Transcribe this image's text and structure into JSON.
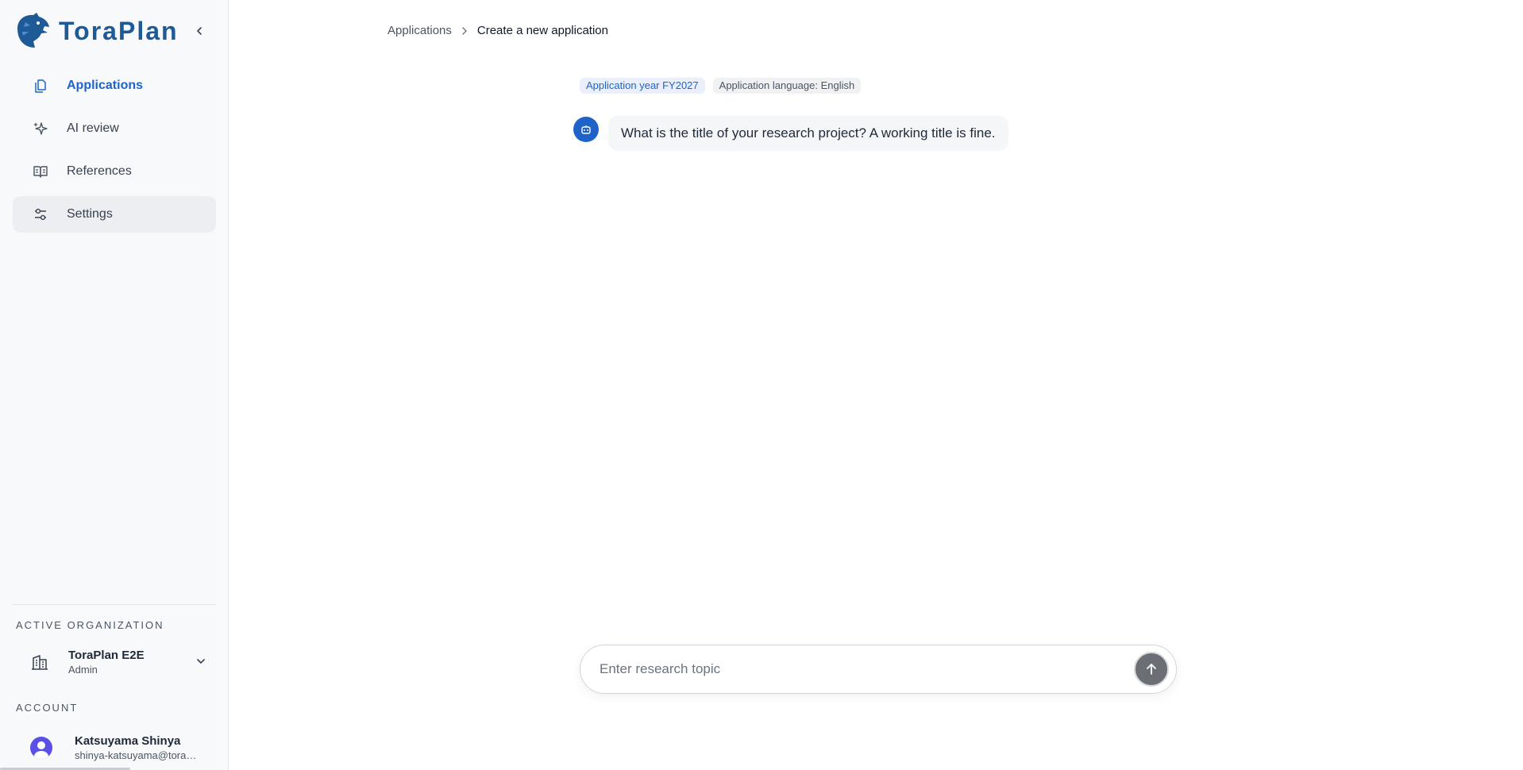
{
  "app": {
    "name": "ToraPlan",
    "brand_color": "#1e5a96",
    "accent_color": "#1f63c9"
  },
  "sidebar": {
    "items": [
      {
        "label": "Applications",
        "icon": "documents-icon",
        "state": "active"
      },
      {
        "label": "AI review",
        "icon": "sparkles-icon",
        "state": "normal"
      },
      {
        "label": "References",
        "icon": "book-open-icon",
        "state": "normal"
      },
      {
        "label": "Settings",
        "icon": "sliders-icon",
        "state": "hover"
      }
    ],
    "active_org_label": "ACTIVE ORGANIZATION",
    "org": {
      "name": "ToraPlan E2E",
      "role": "Admin"
    },
    "account_label": "ACCOUNT",
    "account": {
      "name": "Katsuyama Shinya",
      "email": "shinya-katsuyama@torap…"
    }
  },
  "breadcrumb": {
    "parent": "Applications",
    "current": "Create a new application"
  },
  "tags": {
    "year": "Application year FY2027",
    "language": "Application language: English"
  },
  "chat": {
    "messages": [
      {
        "role": "assistant",
        "text": "What is the title of your research project? A working title is fine."
      }
    ]
  },
  "composer": {
    "value": "",
    "placeholder": "Enter research topic"
  }
}
